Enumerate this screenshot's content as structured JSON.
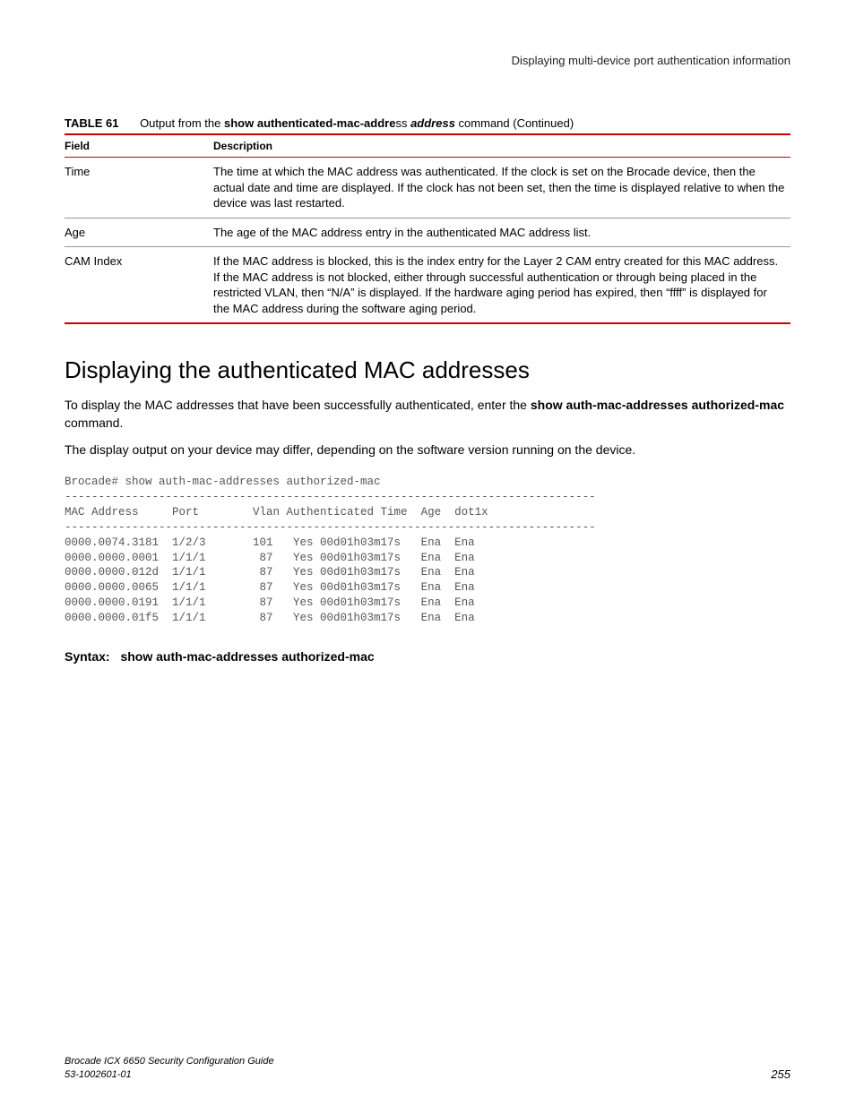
{
  "running_header": "Displaying multi-device port authentication information",
  "table_caption": {
    "label": "TABLE 61",
    "prefix": "Output from the ",
    "cmd_bold": "show authenticated-mac-addre",
    "cmd_tail": "ss ",
    "cmd_italic": "address",
    "suffix": " command (Continued)"
  },
  "table_headers": {
    "field": "Field",
    "desc": "Description"
  },
  "rows": [
    {
      "field": "Time",
      "desc": "The time at which the MAC address was authenticated. If the clock is set on the Brocade device, then the actual date and time are displayed. If the clock has not been set, then the time is displayed relative to when the device was last restarted."
    },
    {
      "field": "Age",
      "desc": "The age of the MAC address entry in the authenticated MAC address list."
    },
    {
      "field": "CAM Index",
      "desc": "If the MAC address is blocked, this is the index entry for the Layer 2 CAM entry created for this MAC address. If the MAC address is not blocked, either through successful authentication or through being placed in the restricted VLAN, then “N/A” is displayed. If the hardware aging period has expired, then “ffff” is displayed for the MAC address during the software aging period."
    }
  ],
  "section_heading": "Displaying the authenticated MAC addresses",
  "para1": {
    "t1": "To display the MAC addresses that have been successfully authenticated, enter the ",
    "b1": "show auth-mac-addresses authorized-mac",
    "t2": " command."
  },
  "para2": "The display output on your device may differ, depending on the software version running on the device.",
  "cli": "Brocade# show auth-mac-addresses authorized-mac\n-------------------------------------------------------------------------------\nMAC Address     Port        Vlan Authenticated Time  Age  dot1x\n-------------------------------------------------------------------------------\n0000.0074.3181  1/2/3       101   Yes 00d01h03m17s   Ena  Ena\n0000.0000.0001  1/1/1        87   Yes 00d01h03m17s   Ena  Ena\n0000.0000.012d  1/1/1        87   Yes 00d01h03m17s   Ena  Ena\n0000.0000.0065  1/1/1        87   Yes 00d01h03m17s   Ena  Ena\n0000.0000.0191  1/1/1        87   Yes 00d01h03m17s   Ena  Ena\n0000.0000.01f5  1/1/1        87   Yes 00d01h03m17s   Ena  Ena",
  "syntax": {
    "label": "Syntax:",
    "cmd": "show auth-mac-addresses authorized-mac"
  },
  "footer": {
    "title": "Brocade ICX 6650 Security Configuration Guide",
    "docnum": "53-1002601-01",
    "page": "255"
  }
}
